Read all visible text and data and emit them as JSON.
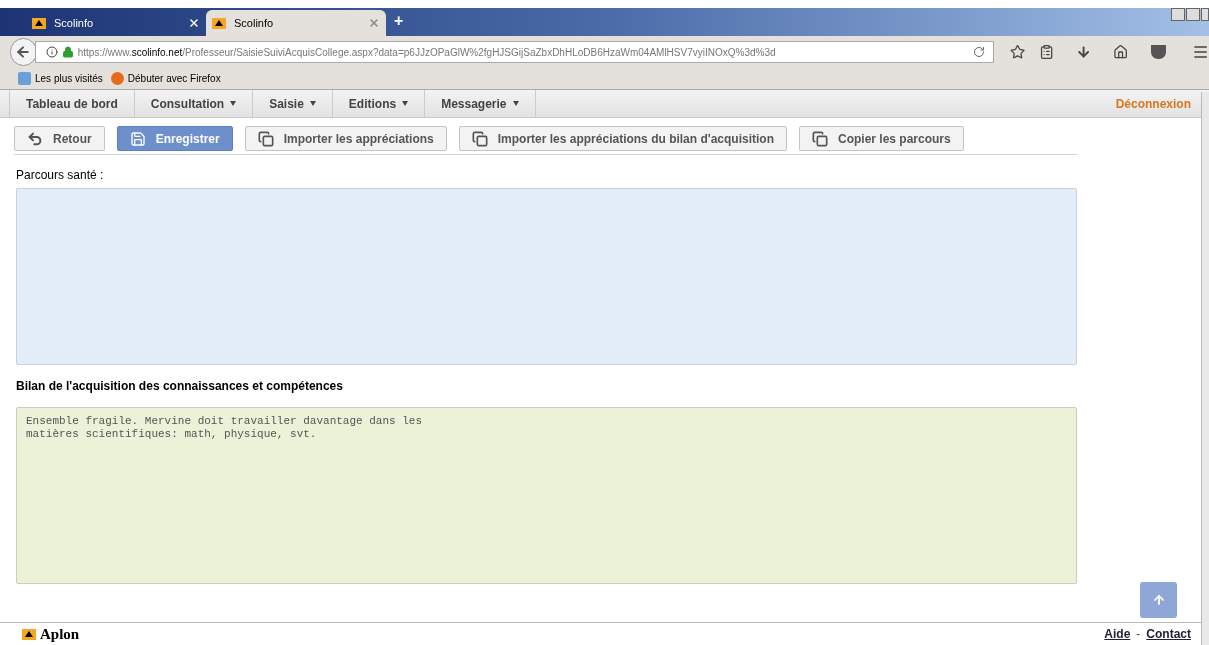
{
  "browser": {
    "tabs": [
      {
        "title": "Scolinfo",
        "selected": false
      },
      {
        "title": "Scolinfo",
        "selected": true
      }
    ],
    "new_tab": "+",
    "url": {
      "prefix": "https://www.",
      "domain": "scolinfo.net",
      "rest": "/Professeur/SaisieSuiviAcquisCollege.aspx?data=p6JJzOPaGlW%2fgHJSGijSaZbxDhHLoDB6HzaWm04AMlHSV7vyiINOxQ%3d%3d"
    },
    "bookmarks": [
      "Les plus visités",
      "Débuter avec Firefox"
    ]
  },
  "menu": {
    "items": [
      {
        "label": "Tableau de bord",
        "dropdown": false
      },
      {
        "label": "Consultation",
        "dropdown": true
      },
      {
        "label": "Saisie",
        "dropdown": true
      },
      {
        "label": "Editions",
        "dropdown": true
      },
      {
        "label": "Messagerie",
        "dropdown": true
      }
    ],
    "logout": "Déconnexion"
  },
  "toolbar": [
    {
      "label": "Retour",
      "kind": "back"
    },
    {
      "label": "Enregistrer",
      "kind": "save"
    },
    {
      "label": "Importer les appréciations",
      "kind": "copy"
    },
    {
      "label": "Importer les appréciations du bilan d'acquisition",
      "kind": "copy"
    },
    {
      "label": "Copier les parcours",
      "kind": "copy"
    }
  ],
  "parcours_sante": {
    "label": "Parcours santé :"
  },
  "bilan": {
    "heading": "Bilan de l'acquisition des connaissances et compétences",
    "value": "Ensemble fragile. Mervine doit travailler davantage dans les\nmatières scientifiques: math, physique, svt."
  },
  "footer": {
    "logo": "Aplon",
    "links": [
      "Aide",
      "Contact"
    ],
    "separator": "-"
  }
}
